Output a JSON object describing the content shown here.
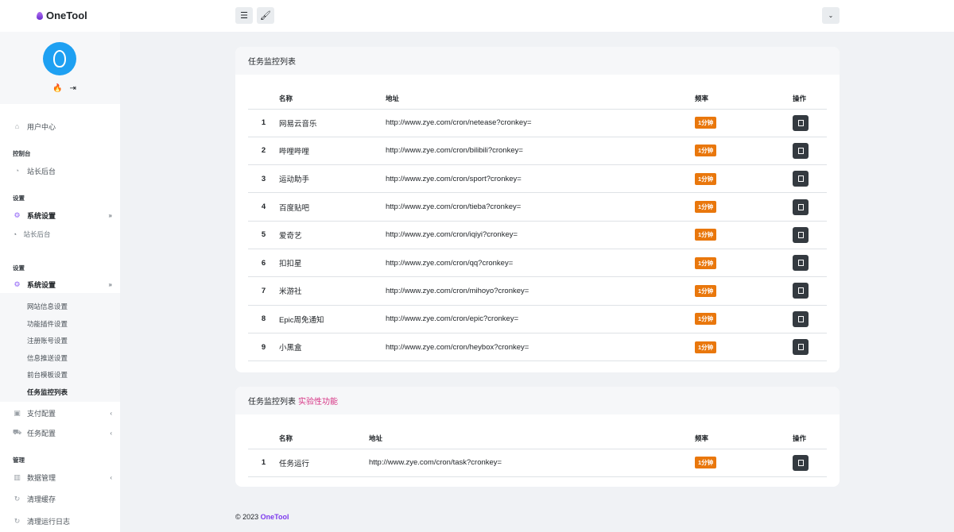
{
  "header": {
    "brand": "OneTool"
  },
  "sidebar": {
    "user_center": "用户中心",
    "section_console": "控制台",
    "site_admin": "站长后台",
    "section_settings": "设置",
    "system_settings": "系统设置",
    "ghost_site_admin": "站长后台",
    "section_settings2": "设置",
    "system_settings2": "系统设置",
    "sub_items": [
      "网站信息设置",
      "功能插件设置",
      "注册账号设置",
      "信息推送设置",
      "前台模板设置",
      "任务监控列表"
    ],
    "pay_config": "支付配置",
    "task_config": "任务配置",
    "section_manage": "管理",
    "data_manage": "数据管理",
    "clear_cache": "清理缓存",
    "clear_logs": "清理运行日志"
  },
  "card1": {
    "title": "任务监控列表",
    "columns": {
      "name": "名称",
      "url": "地址",
      "freq": "频率",
      "action": "操作"
    },
    "rows": [
      {
        "id": "1",
        "name": "网易云音乐",
        "url": "http://www.zye.com/cron/netease?cronkey=",
        "freq": "1分钟"
      },
      {
        "id": "2",
        "name": "哔哩哔哩",
        "url": "http://www.zye.com/cron/bilibili?cronkey=",
        "freq": "1分钟"
      },
      {
        "id": "3",
        "name": "运动助手",
        "url": "http://www.zye.com/cron/sport?cronkey=",
        "freq": "1分钟"
      },
      {
        "id": "4",
        "name": "百度贴吧",
        "url": "http://www.zye.com/cron/tieba?cronkey=",
        "freq": "1分钟"
      },
      {
        "id": "5",
        "name": "爱奇艺",
        "url": "http://www.zye.com/cron/iqiyi?cronkey=",
        "freq": "1分钟"
      },
      {
        "id": "6",
        "name": "扣扣星",
        "url": "http://www.zye.com/cron/qq?cronkey=",
        "freq": "1分钟"
      },
      {
        "id": "7",
        "name": "米游社",
        "url": "http://www.zye.com/cron/mihoyo?cronkey=",
        "freq": "1分钟"
      },
      {
        "id": "8",
        "name": "Epic周免通知",
        "url": "http://www.zye.com/cron/epic?cronkey=",
        "freq": "1分钟"
      },
      {
        "id": "9",
        "name": "小黑盒",
        "url": "http://www.zye.com/cron/heybox?cronkey=",
        "freq": "1分钟"
      }
    ]
  },
  "card2": {
    "title": "任务监控列表",
    "tag": "实验性功能",
    "columns": {
      "name": "名称",
      "url": "地址",
      "freq": "频率",
      "action": "操作"
    },
    "rows": [
      {
        "id": "1",
        "name": "任务运行",
        "url": "http://www.zye.com/cron/task?cronkey=",
        "freq": "1分钟"
      }
    ]
  },
  "footer": {
    "copyright": "© 2023",
    "brand": "OneTool"
  },
  "icons": {
    "menu": "menu-icon",
    "brush": "brush-icon",
    "chevron": "chevron-down-icon",
    "copy": "copy-icon",
    "gear": "gear-icon",
    "home": "home-icon"
  },
  "colors": {
    "badge": "#e9770c",
    "accent": "#7c3aed",
    "avatar": "#1ea0f2",
    "tag": "#d63384"
  }
}
